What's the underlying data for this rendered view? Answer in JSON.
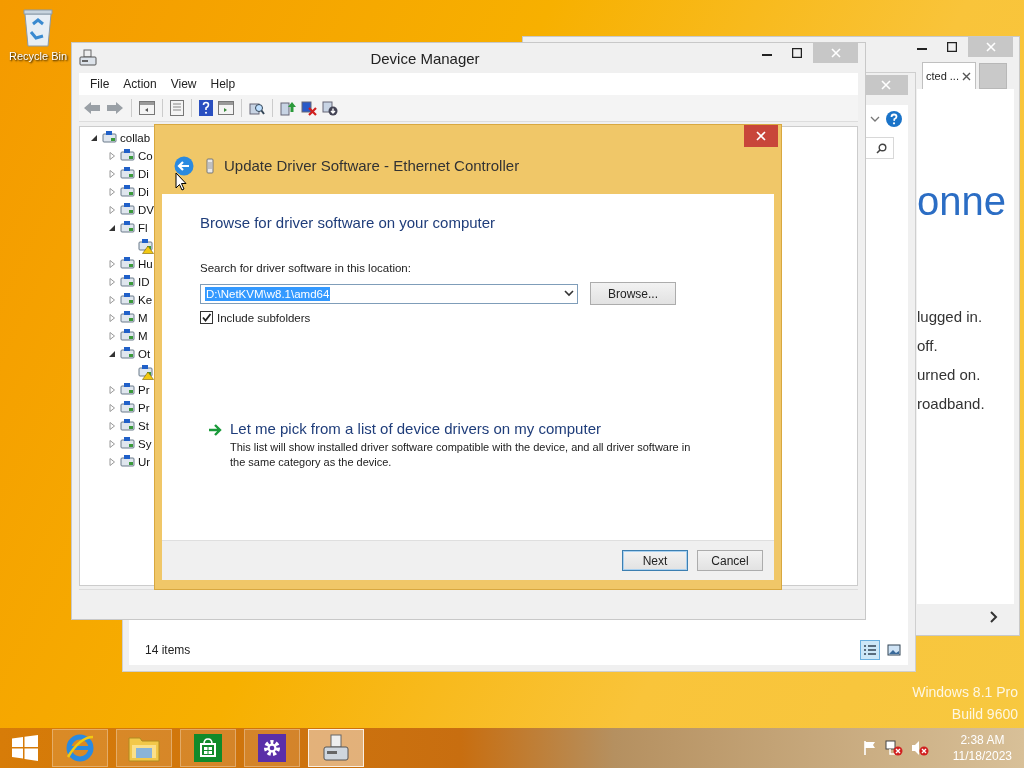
{
  "desktop": {
    "icons": [
      {
        "label": "Recycle Bin"
      }
    ],
    "edition": "Windows 8.1 Pro",
    "build": "Build 9600"
  },
  "browser_window": {
    "tabs": [
      {
        "label": "cted ...",
        "selected": true
      }
    ],
    "heading": "onne",
    "lines": [
      "lugged in.",
      "off.",
      "urned on.",
      "roadband."
    ]
  },
  "explorer_window": {
    "status": "14 items",
    "views": [
      {
        "selected": true
      },
      {
        "selected": false
      }
    ]
  },
  "device_manager": {
    "title": "Device Manager",
    "menu": [
      "File",
      "Action",
      "View",
      "Help"
    ],
    "tree": {
      "label": "collab",
      "expanded": true,
      "children": [
        {
          "label": "Co",
          "expanded": false
        },
        {
          "label": "Di",
          "expanded": false
        },
        {
          "label": "Di",
          "expanded": false
        },
        {
          "label": "DV",
          "expanded": false
        },
        {
          "label": "Fl",
          "expanded": true,
          "children": [
            {
              "warning": true
            }
          ]
        },
        {
          "label": "Hu",
          "expanded": false
        },
        {
          "label": "ID",
          "expanded": false
        },
        {
          "label": "Ke",
          "expanded": false
        },
        {
          "label": "M",
          "expanded": false
        },
        {
          "label": "M",
          "expanded": false
        },
        {
          "label": "Ot",
          "expanded": true,
          "children": [
            {
              "warning": true
            }
          ]
        },
        {
          "label": "Pr",
          "expanded": false
        },
        {
          "label": "Pr",
          "expanded": false
        },
        {
          "label": "St",
          "expanded": false
        },
        {
          "label": "Sy",
          "expanded": false
        },
        {
          "label": "Ur",
          "expanded": false
        }
      ]
    }
  },
  "dialog": {
    "title": "Update Driver Software - Ethernet Controller",
    "heading": "Browse for driver software on your computer",
    "location_label": "Search for driver software in this location:",
    "location": {
      "value": "D:\\NetKVM\\w8.1\\amd64",
      "selected": true
    },
    "browse_button": "Browse...",
    "include_subfolders": {
      "label": "Include subfolders",
      "checked": true
    },
    "pick_link": {
      "label": "Let me pick from a list of device drivers on my computer",
      "description": "This list will show installed driver software compatible with the device, and all driver software in the same category as the device."
    },
    "buttons": [
      {
        "label": "Next",
        "default": true
      },
      {
        "label": "Cancel",
        "default": false
      }
    ]
  },
  "taskbar": {
    "apps": [
      {
        "selected": false
      },
      {
        "selected": false
      },
      {
        "selected": false
      },
      {
        "selected": false
      },
      {
        "selected": true
      }
    ],
    "time": "2:38 AM",
    "date": "11/18/2023"
  }
}
